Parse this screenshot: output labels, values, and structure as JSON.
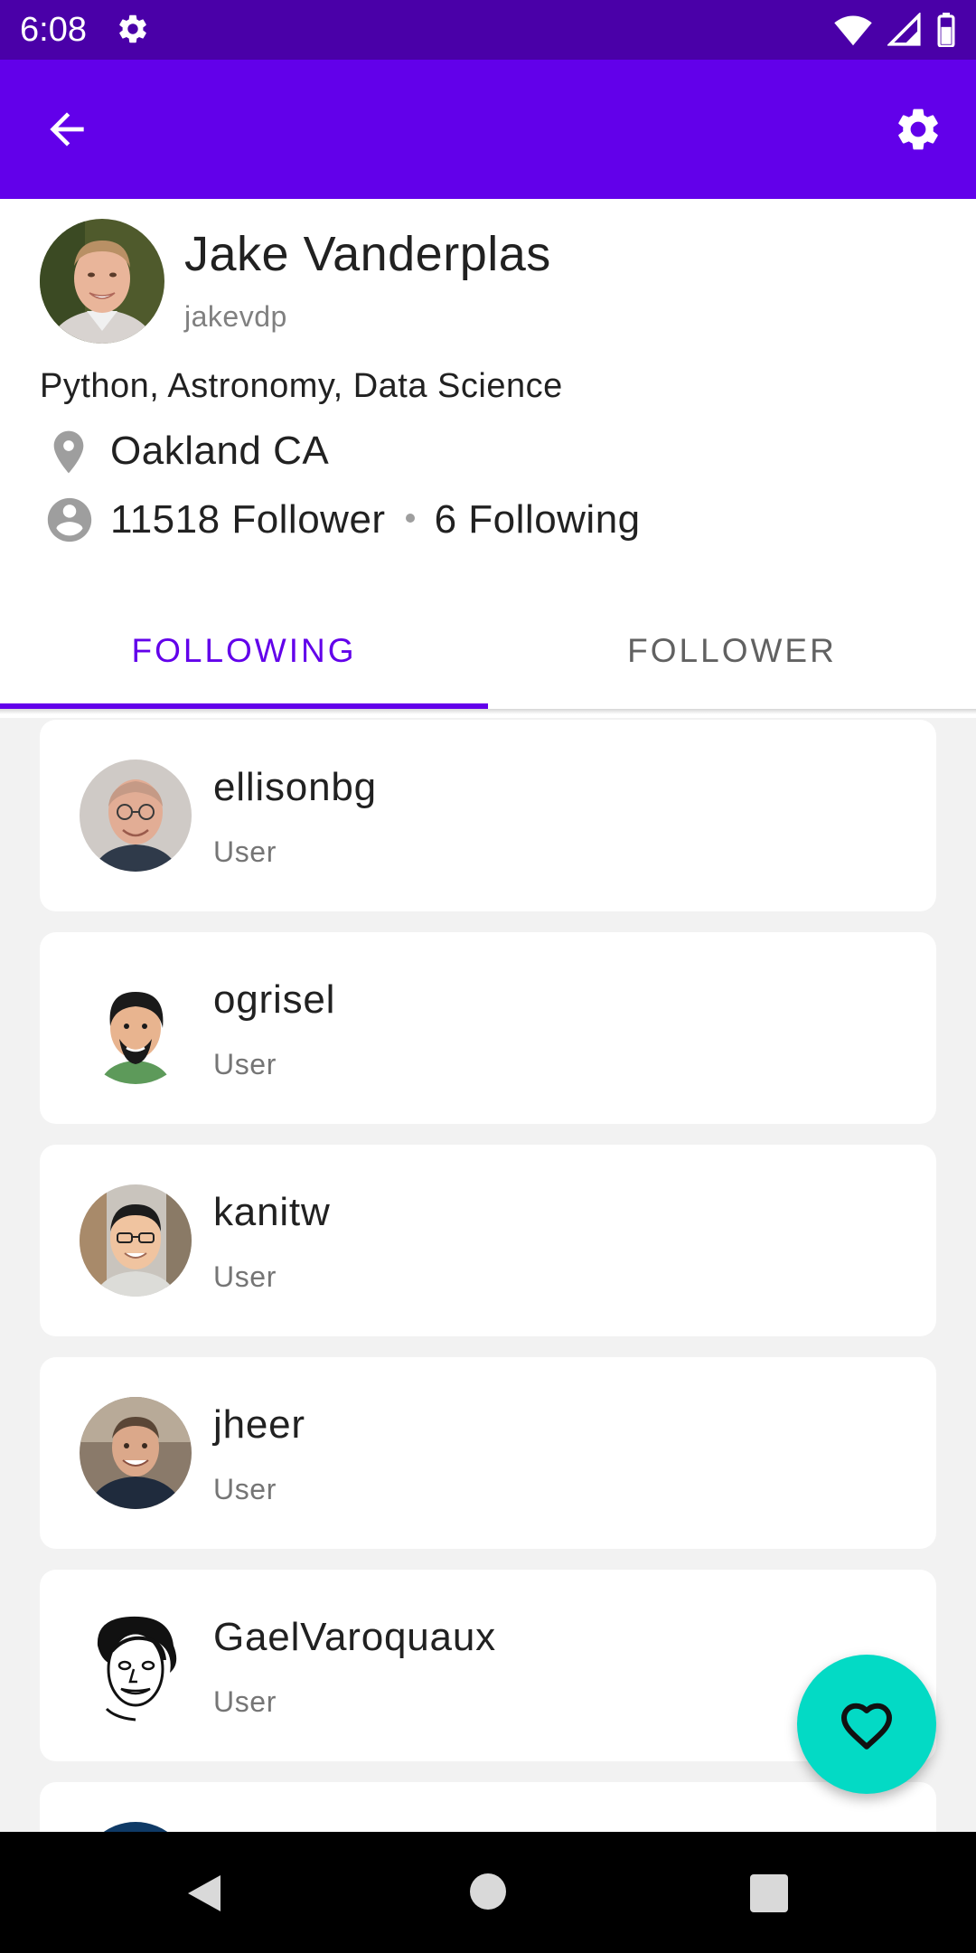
{
  "status_bar": {
    "time": "6:08",
    "icons": [
      "gear-icon",
      "wifi-icon",
      "signal-icon",
      "battery-icon"
    ]
  },
  "app_bar": {
    "background": "#6200ea",
    "back_icon": "arrow-left-icon",
    "settings_icon": "gear-icon"
  },
  "profile": {
    "name": "Jake Vanderplas",
    "login": "jakevdp",
    "bio": "Python, Astronomy, Data Science",
    "location": "Oakland CA",
    "followers": "11518 Follower",
    "following": "6 Following"
  },
  "tabs": [
    {
      "label": "FOLLOWING",
      "selected": true
    },
    {
      "label": "FOLLOWER",
      "selected": false
    }
  ],
  "users": [
    {
      "name": "ellisonbg",
      "type": "User"
    },
    {
      "name": "ogrisel",
      "type": "User"
    },
    {
      "name": "kanitw",
      "type": "User"
    },
    {
      "name": "jheer",
      "type": "User"
    },
    {
      "name": "GaelVaroquaux",
      "type": "User"
    }
  ],
  "fab": {
    "icon": "heart-outline-icon",
    "color": "#03dac5"
  },
  "colors": {
    "primary": "#6200ea",
    "primary_dark": "#4a00a8",
    "accent": "#03dac5"
  }
}
